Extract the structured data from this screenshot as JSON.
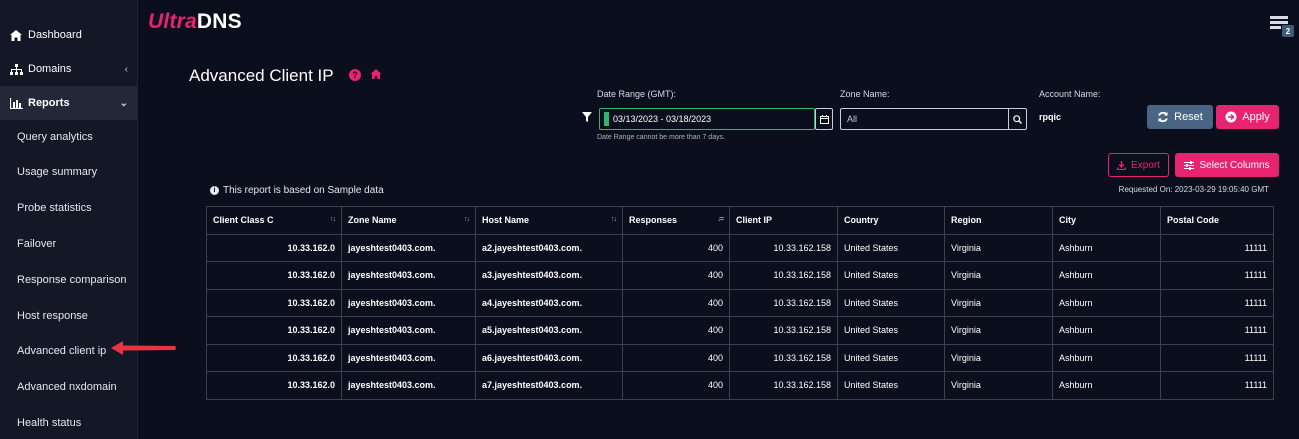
{
  "app": {
    "brand_part1": "Ultra",
    "brand_part2": "DNS",
    "menu_badge": "2",
    "accent": "#e8236f"
  },
  "sidebar": {
    "main": [
      {
        "label": "Dashboard",
        "icon": "home-icon"
      },
      {
        "label": "Domains",
        "icon": "sitemap-icon"
      },
      {
        "label": "Reports",
        "icon": "bar-chart-icon"
      }
    ],
    "reports_sub": [
      "Query analytics",
      "Usage summary",
      "Probe statistics",
      "Failover",
      "Response comparison",
      "Host response",
      "Advanced client ip",
      "Advanced nxdomain",
      "Health status"
    ]
  },
  "page": {
    "title": "Advanced Client IP"
  },
  "filters": {
    "date_label": "Date Range (GMT):",
    "date_value": "03/13/2023 - 03/18/2023",
    "date_hint": "Date Range cannot be more than 7 days.",
    "zone_label": "Zone Name:",
    "zone_value": "All",
    "account_label": "Account Name:",
    "account_value": "rpqic"
  },
  "actions": {
    "reset": "Reset",
    "apply": "Apply",
    "export": "Export",
    "select_columns": "Select Columns"
  },
  "report": {
    "sample_note": "This report is based on Sample data",
    "requested_label": "Requested On: ",
    "requested_value": "2023-03-29 19:05:40 GMT"
  },
  "table": {
    "columns": [
      "Client Class C",
      "Zone Name",
      "Host Name",
      "Responses",
      "Client IP",
      "Country",
      "Region",
      "City",
      "Postal Code"
    ],
    "rows": [
      [
        "10.33.162.0",
        "jayeshtest0403.com.",
        "a2.jayeshtest0403.com.",
        "400",
        "10.33.162.158",
        "United States",
        "Virginia",
        "Ashburn",
        "11111"
      ],
      [
        "10.33.162.0",
        "jayeshtest0403.com.",
        "a3.jayeshtest0403.com.",
        "400",
        "10.33.162.158",
        "United States",
        "Virginia",
        "Ashburn",
        "11111"
      ],
      [
        "10.33.162.0",
        "jayeshtest0403.com.",
        "a4.jayeshtest0403.com.",
        "400",
        "10.33.162.158",
        "United States",
        "Virginia",
        "Ashburn",
        "11111"
      ],
      [
        "10.33.162.0",
        "jayeshtest0403.com.",
        "a5.jayeshtest0403.com.",
        "400",
        "10.33.162.158",
        "United States",
        "Virginia",
        "Ashburn",
        "11111"
      ],
      [
        "10.33.162.0",
        "jayeshtest0403.com.",
        "a6.jayeshtest0403.com.",
        "400",
        "10.33.162.158",
        "United States",
        "Virginia",
        "Ashburn",
        "11111"
      ],
      [
        "10.33.162.0",
        "jayeshtest0403.com.",
        "a7.jayeshtest0403.com.",
        "400",
        "10.33.162.158",
        "United States",
        "Virginia",
        "Ashburn",
        "11111"
      ]
    ]
  }
}
